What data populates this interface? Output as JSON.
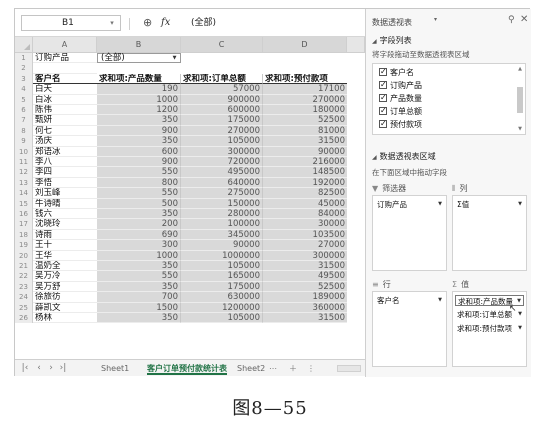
{
  "formula_bar": {
    "cell_ref": "B1",
    "formula_value": "(全部)"
  },
  "columns": [
    "A",
    "B",
    "C",
    "D"
  ],
  "filter": {
    "label": "订购产品",
    "value": "(全部)"
  },
  "headers": [
    "客户名",
    "求和项:产品数量",
    "求和项:订单总额",
    "求和项:预付款项"
  ],
  "rows": [
    [
      "白天",
      "190",
      "57000",
      "17100"
    ],
    [
      "白冰",
      "1000",
      "900000",
      "270000"
    ],
    [
      "陈伟",
      "1200",
      "600000",
      "180000"
    ],
    [
      "甄妍",
      "350",
      "175000",
      "52500"
    ],
    [
      "何七",
      "900",
      "270000",
      "81000"
    ],
    [
      "汤庆",
      "350",
      "105000",
      "31500"
    ],
    [
      "郑语冰",
      "600",
      "300000",
      "90000"
    ],
    [
      "李八",
      "900",
      "720000",
      "216000"
    ],
    [
      "李四",
      "550",
      "495000",
      "148500"
    ],
    [
      "李悟",
      "800",
      "640000",
      "192000"
    ],
    [
      "刘玉峰",
      "550",
      "275000",
      "82500"
    ],
    [
      "牛诗晴",
      "500",
      "150000",
      "45000"
    ],
    [
      "钱六",
      "350",
      "280000",
      "84000"
    ],
    [
      "沈晓玲",
      "200",
      "100000",
      "30000"
    ],
    [
      "诗雨",
      "690",
      "345000",
      "103500"
    ],
    [
      "王十",
      "300",
      "90000",
      "27000"
    ],
    [
      "王华",
      "1000",
      "1000000",
      "300000"
    ],
    [
      "温奶全",
      "350",
      "105000",
      "31500"
    ],
    [
      "吴万冷",
      "550",
      "165000",
      "49500"
    ],
    [
      "吴万舒",
      "350",
      "175000",
      "52500"
    ],
    [
      "徐旅彷",
      "700",
      "630000",
      "189000"
    ],
    [
      "薛凯文",
      "1500",
      "1200000",
      "360000"
    ],
    [
      "杨林",
      "350",
      "105000",
      "31500"
    ]
  ],
  "sheet_tabs": [
    "Sheet1",
    "客户订单预付款统计表",
    "Sheet2"
  ],
  "pane": {
    "title": "数据透视表",
    "field_list_header": "字段列表",
    "field_list_hint": "将字段拖动至数据透视表区域",
    "fields": [
      {
        "label": "客户名",
        "checked": true
      },
      {
        "label": "订购产品",
        "checked": true
      },
      {
        "label": "产品数量",
        "checked": true
      },
      {
        "label": "订单总额",
        "checked": true
      },
      {
        "label": "预付款项",
        "checked": true
      }
    ],
    "areas_header": "数据透视表区域",
    "areas_hint": "在下面区域中拖动字段",
    "filter_area_label": "筛选器",
    "column_area_label": "列",
    "row_area_label": "行",
    "values_area_label": "值",
    "filter_chip": "订购产品",
    "column_chip": "Σ值",
    "row_chip": "客户名",
    "value_chips": [
      "求和项:产品数量",
      "求和项:订单总额",
      "求和项:预付款项"
    ]
  },
  "caption": "图8—55"
}
